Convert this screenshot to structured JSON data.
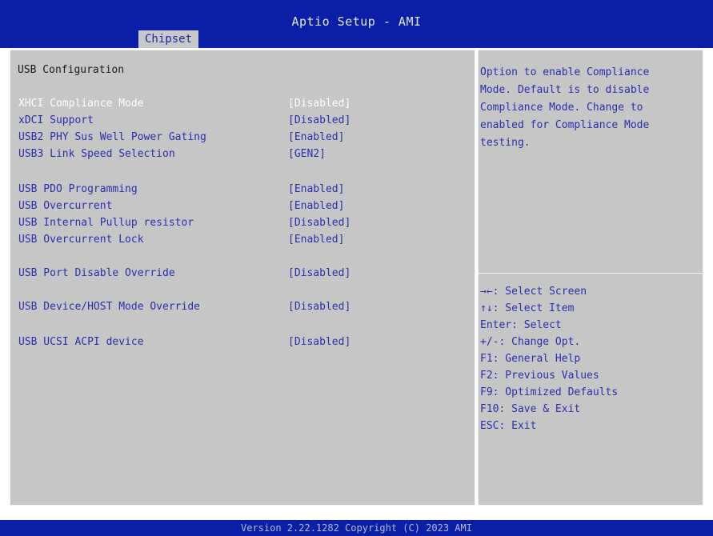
{
  "header": {
    "title": "Aptio Setup - AMI",
    "active_tab": "Chipset"
  },
  "main": {
    "section_title": "USB Configuration",
    "settings": [
      {
        "label": "XHCI Compliance Mode",
        "value": "[Disabled]",
        "selected": true
      },
      {
        "label": "xDCI Support",
        "value": "[Disabled]"
      },
      {
        "label": "USB2 PHY Sus Well Power Gating",
        "value": "[Enabled]"
      },
      {
        "label": "USB3 Link Speed Selection",
        "value": "[GEN2]"
      },
      {
        "label": "USB PDO Programming",
        "value": "[Enabled]"
      },
      {
        "label": "USB Overcurrent",
        "value": "[Enabled]"
      },
      {
        "label": "USB Internal Pullup resistor",
        "value": "[Disabled]"
      },
      {
        "label": "USB Overcurrent Lock",
        "value": "[Enabled]"
      },
      {
        "label": "USB Port Disable Override",
        "value": "[Disabled]"
      },
      {
        "label": "USB Device/HOST Mode Override",
        "value": "[Disabled]"
      },
      {
        "label": "USB UCSI ACPI device",
        "value": "[Disabled]"
      }
    ]
  },
  "help": {
    "description": "Option to enable Compliance\nMode. Default is to disable\nCompliance Mode. Change to\nenabled for Compliance Mode\ntesting.",
    "keys": [
      "→←: Select Screen",
      "↑↓: Select Item",
      "Enter: Select",
      "+/-: Change Opt.",
      "F1: General Help",
      "F2: Previous Values",
      "F9: Optimized Defaults",
      "F10: Save & Exit",
      "ESC: Exit"
    ]
  },
  "footer": {
    "version": "Version 2.22.1282 Copyright (C) 2023 AMI"
  },
  "colors": {
    "header_bg": "#0b1ea8",
    "panel_bg": "#c6c6c6",
    "option_text": "#2830a8",
    "selected_text": "#ffffff"
  }
}
